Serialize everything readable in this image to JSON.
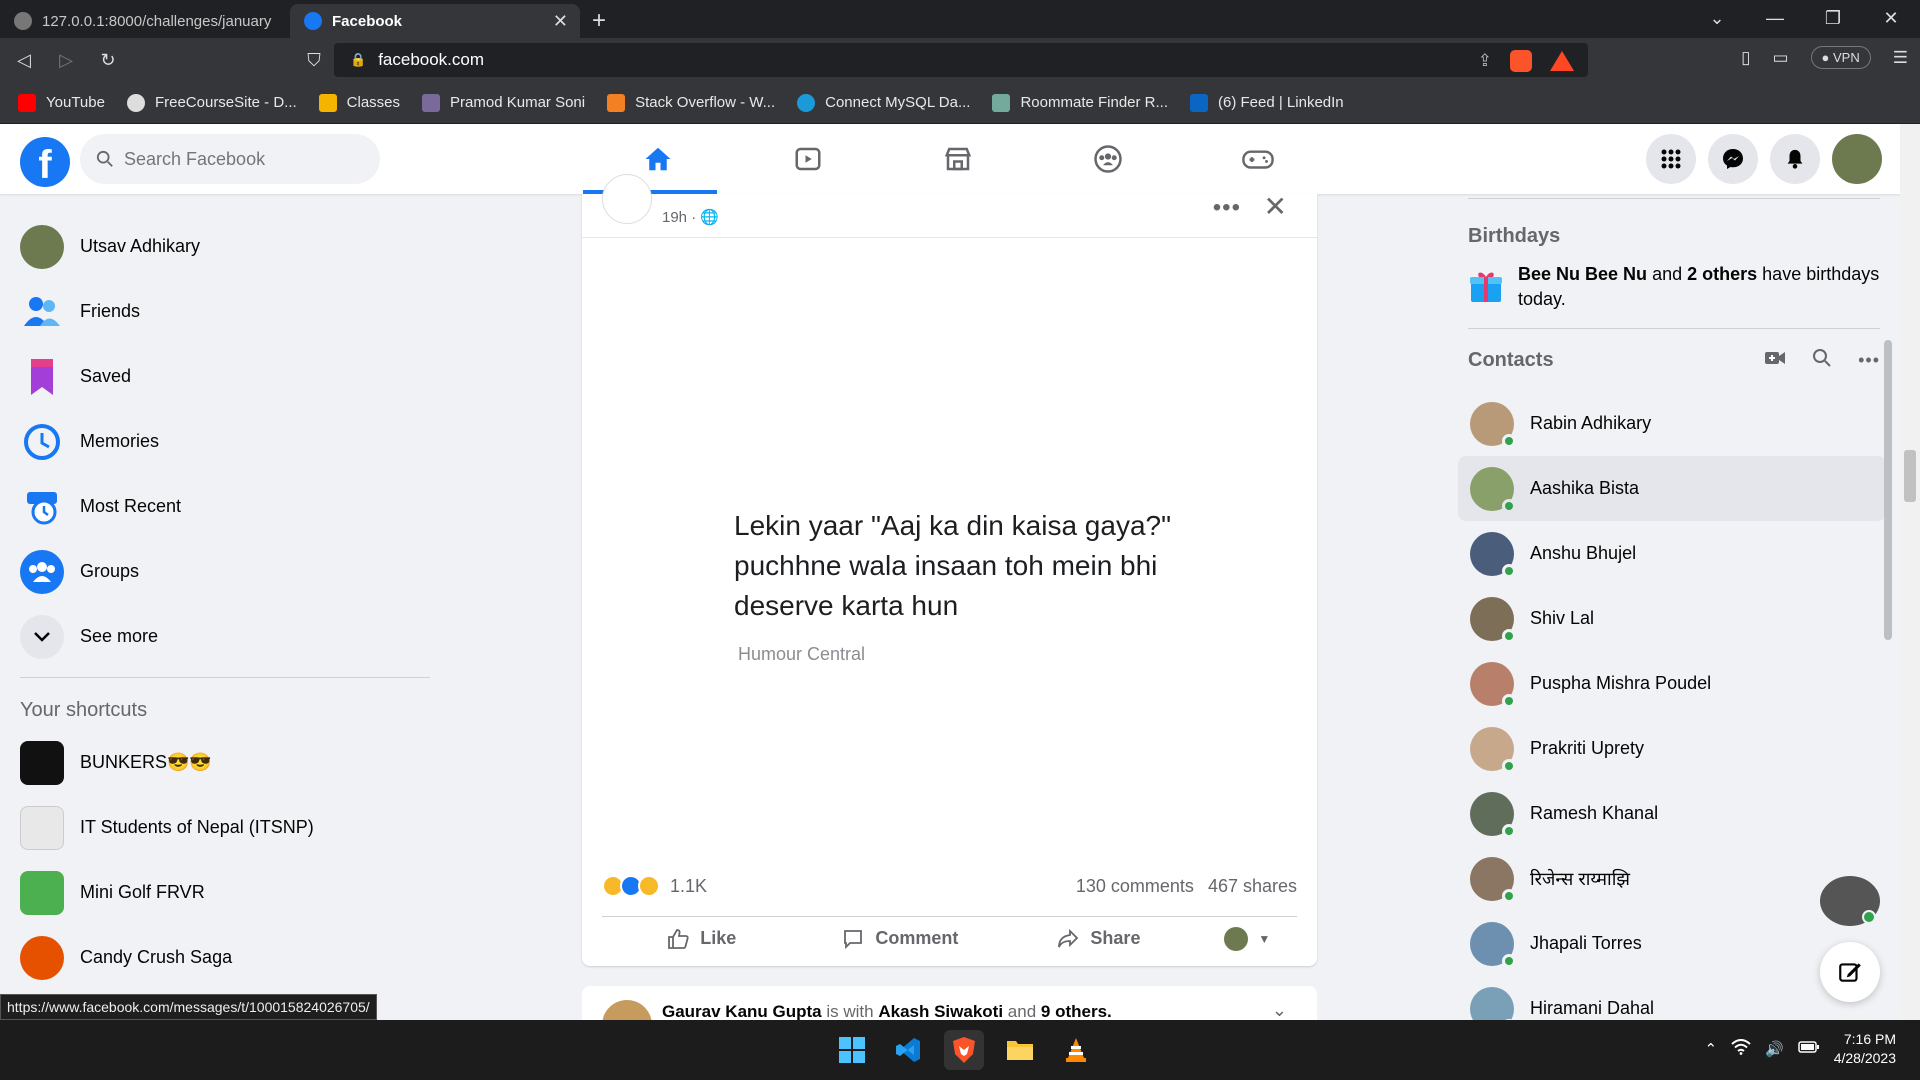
{
  "browser": {
    "tabs": [
      {
        "title": "127.0.0.1:8000/challenges/january",
        "active": false
      },
      {
        "title": "Facebook",
        "active": true
      }
    ],
    "url": "facebook.com",
    "vpn_label": "VPN",
    "brave_count": "2",
    "rewards_count": "1",
    "bookmarks": [
      {
        "label": "YouTube",
        "color": "#ff0000"
      },
      {
        "label": "FreeCourseSite - D...",
        "color": "#dddddd"
      },
      {
        "label": "Classes",
        "color": "#f4b400"
      },
      {
        "label": "Pramod Kumar Soni",
        "color": "#7a6a9a"
      },
      {
        "label": "Stack Overflow - W...",
        "color": "#f48024"
      },
      {
        "label": "Connect MySQL Da...",
        "color": "#1a9ad6"
      },
      {
        "label": "Roommate Finder R...",
        "color": "#74aa9c"
      },
      {
        "label": "(6) Feed | LinkedIn",
        "color": "#0a66c2"
      }
    ]
  },
  "header": {
    "search_placeholder": "Search Facebook"
  },
  "left_nav": {
    "items": [
      {
        "label": "Utsav Adhikary",
        "icon": "profile-avatar"
      },
      {
        "label": "Friends",
        "icon": "friends-icon"
      },
      {
        "label": "Saved",
        "icon": "saved-icon"
      },
      {
        "label": "Memories",
        "icon": "memories-icon"
      },
      {
        "label": "Most Recent",
        "icon": "most-recent-icon"
      },
      {
        "label": "Groups",
        "icon": "groups-icon"
      },
      {
        "label": "See more",
        "icon": "chevron-down-icon"
      }
    ],
    "shortcuts_title": "Your shortcuts",
    "shortcuts": [
      {
        "label": "BUNKERS😎😎",
        "color": "#111111"
      },
      {
        "label": "IT Students of Nepal (ITSNP)",
        "color": "#e8e8e8"
      },
      {
        "label": "Mini Golf FRVR",
        "color": "#4caf50"
      },
      {
        "label": "Candy Crush Saga",
        "color": "#e65100"
      }
    ]
  },
  "post": {
    "time": "19h · 🌐",
    "quote": "Lekin yaar \"Aaj ka din kaisa gaya?\" puchhne wala insaan toh mein bhi deserve karta hun",
    "credit": "Humour Central",
    "reactions_count": "1.1K",
    "comments": "130 comments",
    "shares": "467 shares",
    "like_label": "Like",
    "comment_label": "Comment",
    "share_label": "Share"
  },
  "next_post": {
    "author": "Gaurav Kanu Gupta",
    "with_text": "is with",
    "tagged": "Akash Siwakoti",
    "and_text": "and",
    "others": "9 others."
  },
  "right_col": {
    "birthdays_title": "Birthdays",
    "birthday_name": "Bee Nu Bee Nu",
    "birthday_and": "and",
    "birthday_others": "2 others",
    "birthday_rest": "have birthdays today.",
    "contacts_title": "Contacts",
    "contacts": [
      {
        "name": "Rabin Adhikary",
        "color": "#b89a78"
      },
      {
        "name": "Aashika Bista",
        "color": "#8aa06a"
      },
      {
        "name": "Anshu Bhujel",
        "color": "#4a5d7a"
      },
      {
        "name": "Shiv Lal",
        "color": "#7d6e58"
      },
      {
        "name": "Puspha Mishra Poudel",
        "color": "#b8806a"
      },
      {
        "name": "Prakriti Uprety",
        "color": "#c7a88a"
      },
      {
        "name": "Ramesh Khanal",
        "color": "#5f6d5a"
      },
      {
        "name": "रिजेन्स राय्माझि",
        "color": "#8b7563"
      },
      {
        "name": "Jhapali Torres",
        "color": "#6d8fb0"
      },
      {
        "name": "Hiramani Dahal",
        "color": "#7aa0b8"
      }
    ]
  },
  "status_url": "https://www.facebook.com/messages/t/100015824026705/",
  "taskbar": {
    "time": "7:16 PM",
    "date": "4/28/2023"
  },
  "colors": {
    "brand": "#1877f2",
    "online": "#31a24c"
  }
}
